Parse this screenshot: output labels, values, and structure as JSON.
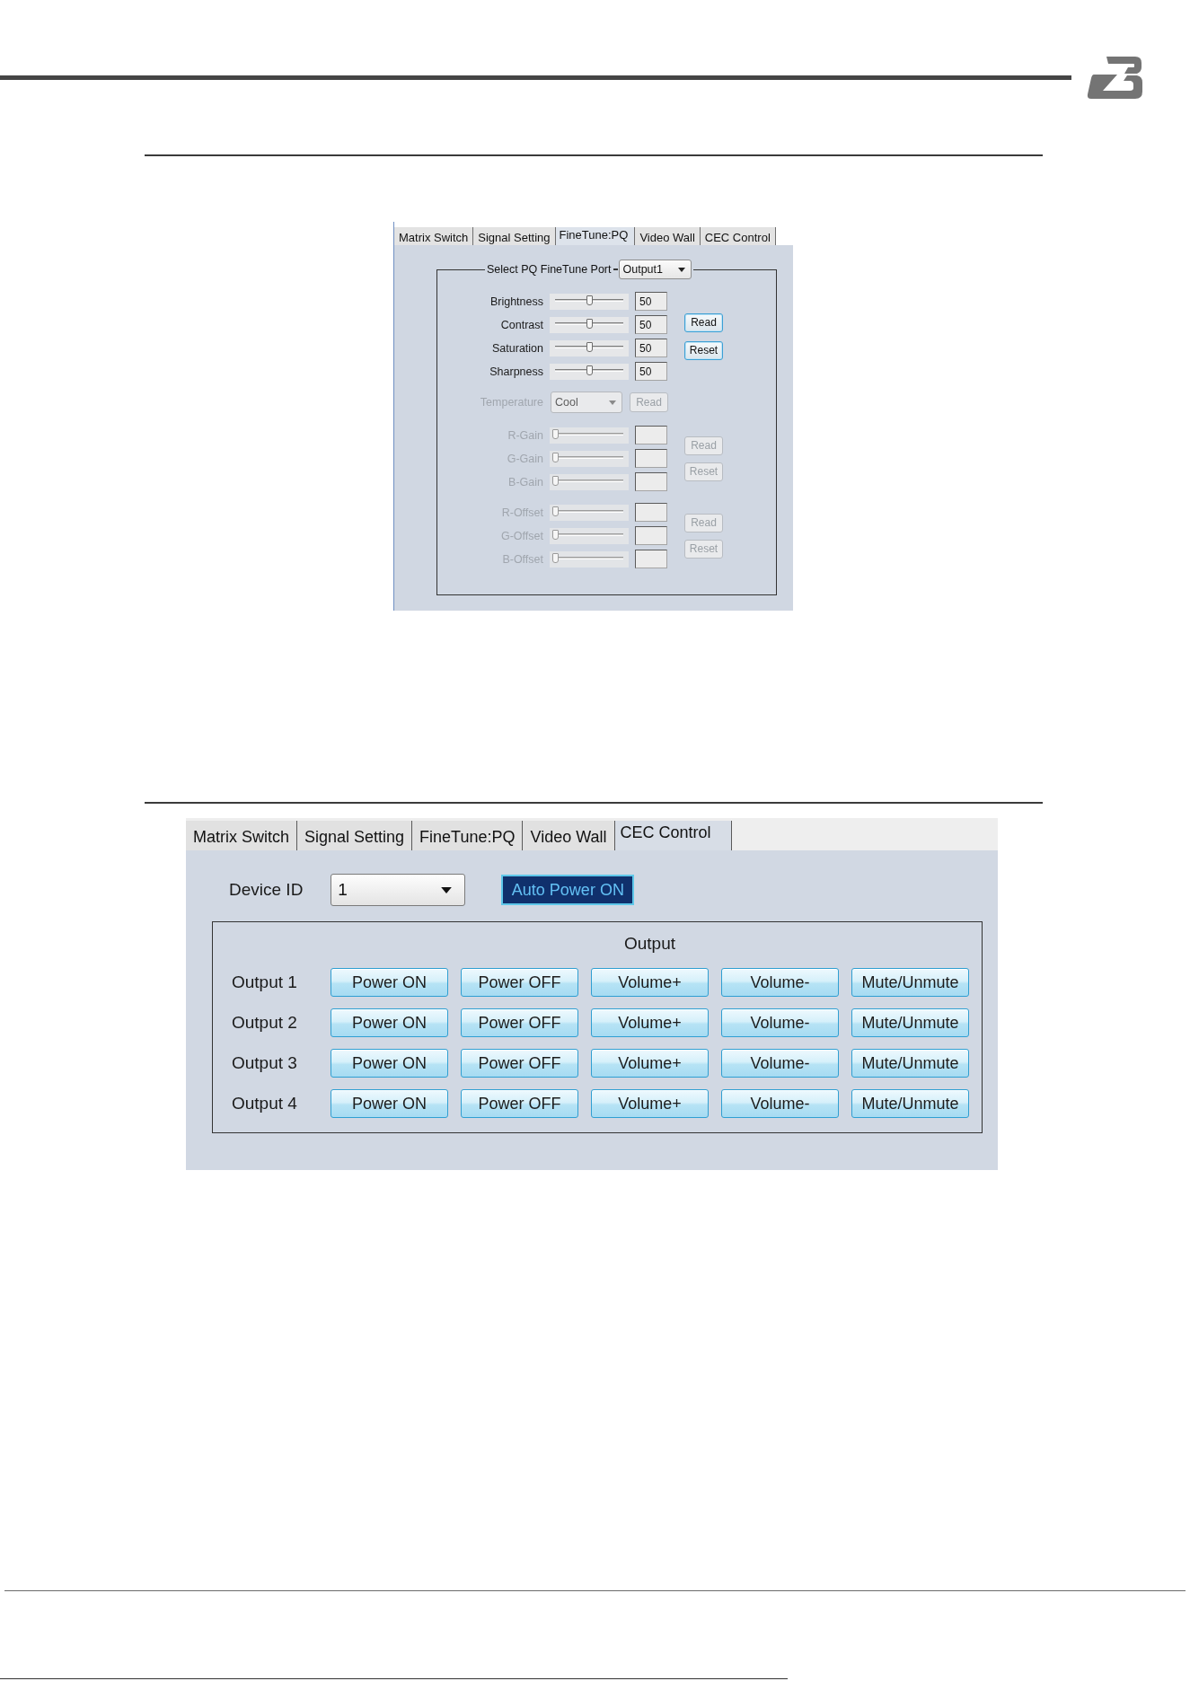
{
  "finetune_panel": {
    "tabs": [
      {
        "label": "Matrix Switch",
        "selected": false
      },
      {
        "label": "Signal Setting",
        "selected": false
      },
      {
        "label": "FineTune:PQ",
        "selected": true
      },
      {
        "label": "Video Wall",
        "selected": false
      },
      {
        "label": "CEC Control",
        "selected": false
      }
    ],
    "port_select": {
      "label": "Select PQ FineTune Port",
      "value": "Output1"
    },
    "picture_controls": {
      "sliders": [
        {
          "label": "Brightness",
          "level": 0.5,
          "value": "50",
          "disabled": false
        },
        {
          "label": "Contrast",
          "level": 0.5,
          "value": "50",
          "disabled": false
        },
        {
          "label": "Saturation",
          "level": 0.5,
          "value": "50",
          "disabled": false
        },
        {
          "label": "Sharpness",
          "level": 0.5,
          "value": "50",
          "disabled": false
        }
      ],
      "buttons": [
        {
          "label": "Read",
          "disabled": false
        },
        {
          "label": "Reset",
          "disabled": false
        }
      ]
    },
    "temperature": {
      "label": "Temperature",
      "value": "Cool",
      "disabled": true,
      "button": {
        "label": "Read",
        "disabled": true
      }
    },
    "gain_controls": {
      "sliders": [
        {
          "label": "R-Gain",
          "level": 0,
          "disabled": true
        },
        {
          "label": "G-Gain",
          "level": 0,
          "disabled": true
        },
        {
          "label": "B-Gain",
          "level": 0,
          "disabled": true
        }
      ],
      "buttons": [
        {
          "label": "Read",
          "disabled": true
        },
        {
          "label": "Reset",
          "disabled": true
        }
      ]
    },
    "offset_controls": {
      "sliders": [
        {
          "label": "R-Offset",
          "level": 0,
          "disabled": true
        },
        {
          "label": "G-Offset",
          "level": 0,
          "disabled": true
        },
        {
          "label": "B-Offset",
          "level": 0,
          "disabled": true
        }
      ],
      "buttons": [
        {
          "label": "Read",
          "disabled": true
        },
        {
          "label": "Reset",
          "disabled": true
        }
      ]
    }
  },
  "cec_panel": {
    "tabs": [
      {
        "label": "Matrix Switch",
        "selected": false
      },
      {
        "label": "Signal Setting",
        "selected": false
      },
      {
        "label": "FineTune:PQ",
        "selected": false
      },
      {
        "label": "Video Wall",
        "selected": false
      },
      {
        "label": "CEC Control",
        "selected": true
      }
    ],
    "device_id": {
      "label": "Device ID",
      "value": "1"
    },
    "auto_power": {
      "label": "Auto Power ON",
      "highlighted": true
    },
    "output_group": {
      "title": "Output",
      "rows": [
        {
          "label": "Output 1",
          "buttons": [
            "Power ON",
            "Power OFF",
            "Volume+",
            "Volume-",
            "Mute/Unmute"
          ]
        },
        {
          "label": "Output 2",
          "buttons": [
            "Power ON",
            "Power OFF",
            "Volume+",
            "Volume-",
            "Mute/Unmute"
          ]
        },
        {
          "label": "Output 3",
          "buttons": [
            "Power ON",
            "Power OFF",
            "Volume+",
            "Volume-",
            "Mute/Unmute"
          ]
        },
        {
          "label": "Output 4",
          "buttons": [
            "Power ON",
            "Power OFF",
            "Volume+",
            "Volume-",
            "Mute/Unmute"
          ]
        }
      ]
    }
  }
}
